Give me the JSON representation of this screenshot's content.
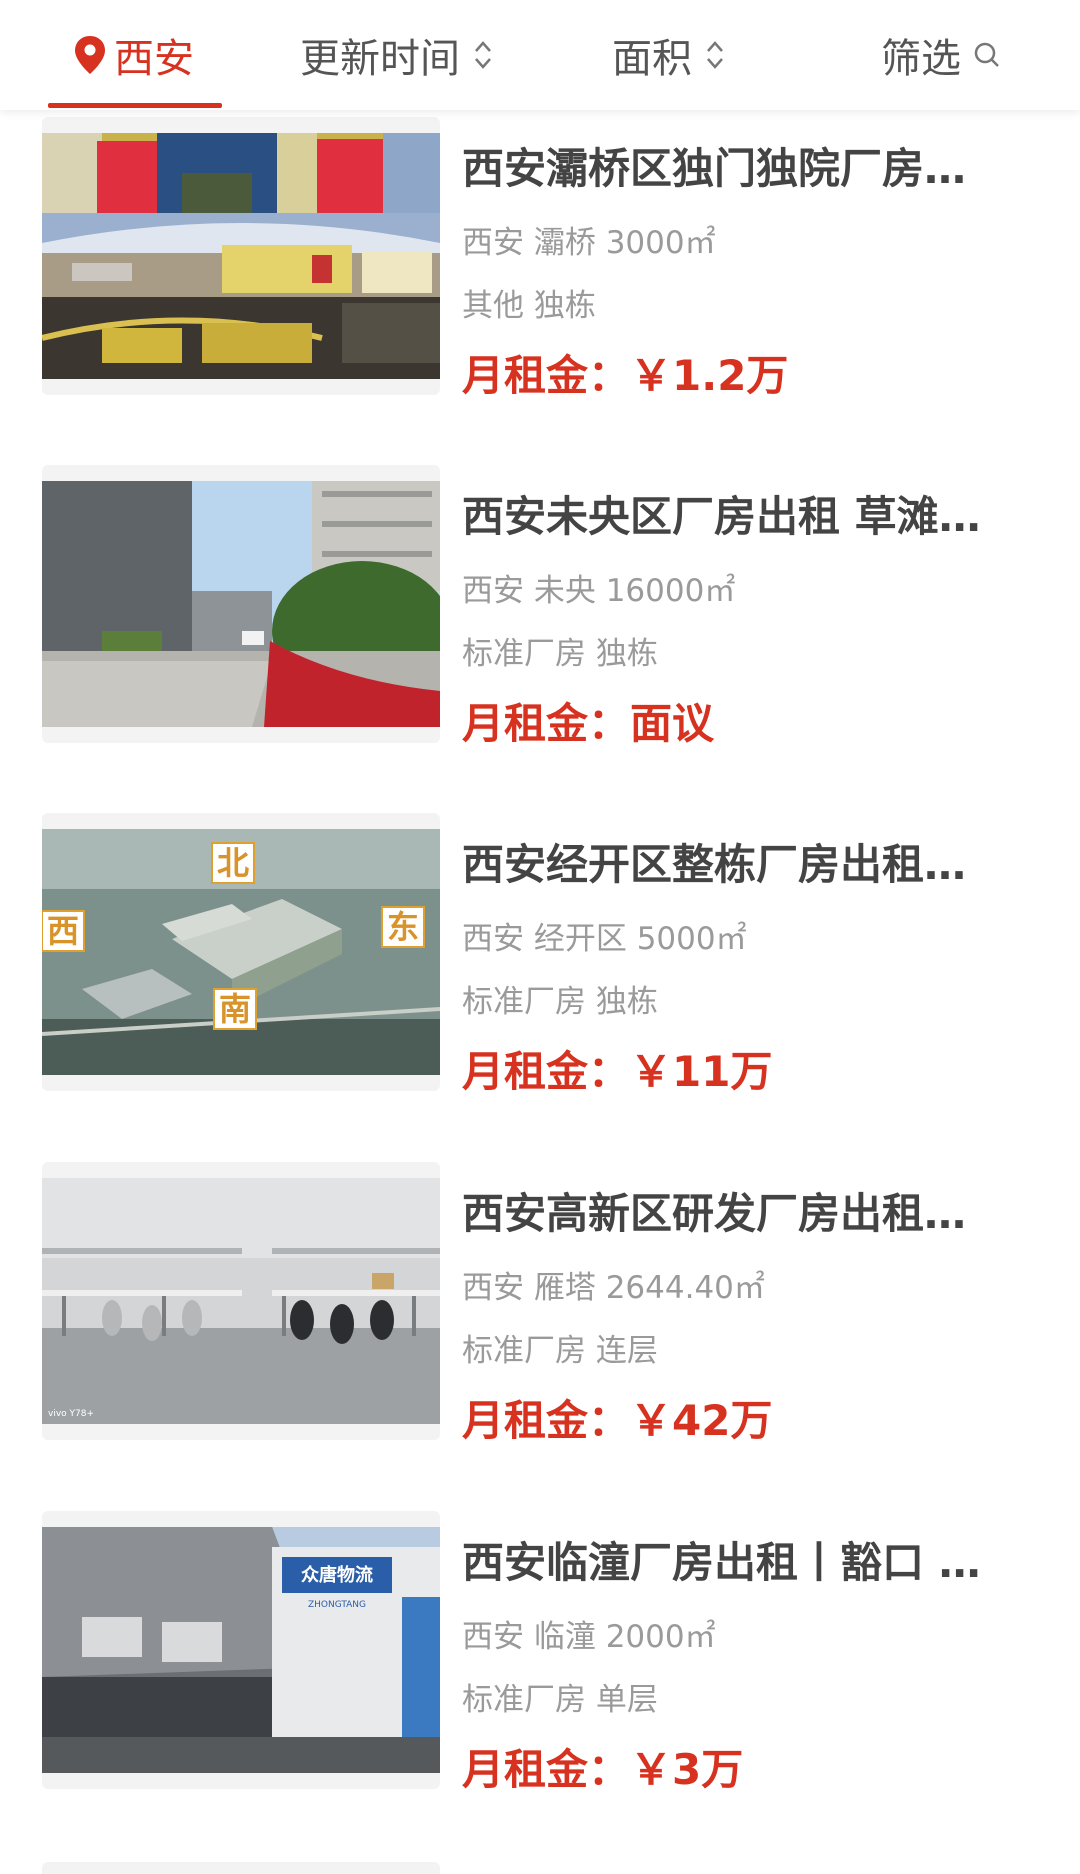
{
  "filter_bar": {
    "city": "西安",
    "update_time": "更新时间",
    "area": "面积",
    "filter": "筛选"
  },
  "colors": {
    "accent": "#d7311f",
    "title": "#444444",
    "meta": "#9a9a9a"
  },
  "listings": [
    {
      "title": "西安灞桥区独门独院厂房…",
      "location": "西安 灞桥 3000㎡",
      "type": "其他 独栋",
      "price_label": "月租金：",
      "price_value": "￥1.2万"
    },
    {
      "title": "西安未央区厂房出租 草滩…",
      "location": "西安 未央 16000㎡",
      "type": "标准厂房 独栋",
      "price_label": "月租金：",
      "price_value": "面议"
    },
    {
      "title": "西安经开区整栋厂房出租…",
      "location": "西安 经开区 5000㎡",
      "type": "标准厂房 独栋",
      "price_label": "月租金：",
      "price_value": "￥11万",
      "photo_labels": [
        "北",
        "西",
        "东",
        "南"
      ]
    },
    {
      "title": "西安高新区研发厂房出租…",
      "location": "西安 雁塔 2644.40㎡",
      "type": "标准厂房 连层",
      "price_label": "月租金：",
      "price_value": "￥42万",
      "photo_watermark": "vivo Y78+"
    },
    {
      "title": "西安临潼厂房出租丨豁口 …",
      "location": "西安 临潼 2000㎡",
      "type": "标准厂房 单层",
      "price_label": "月租金：",
      "price_value": "￥3万",
      "photo_labels": [
        "众唐物流",
        "ZHONGTANG"
      ]
    }
  ]
}
